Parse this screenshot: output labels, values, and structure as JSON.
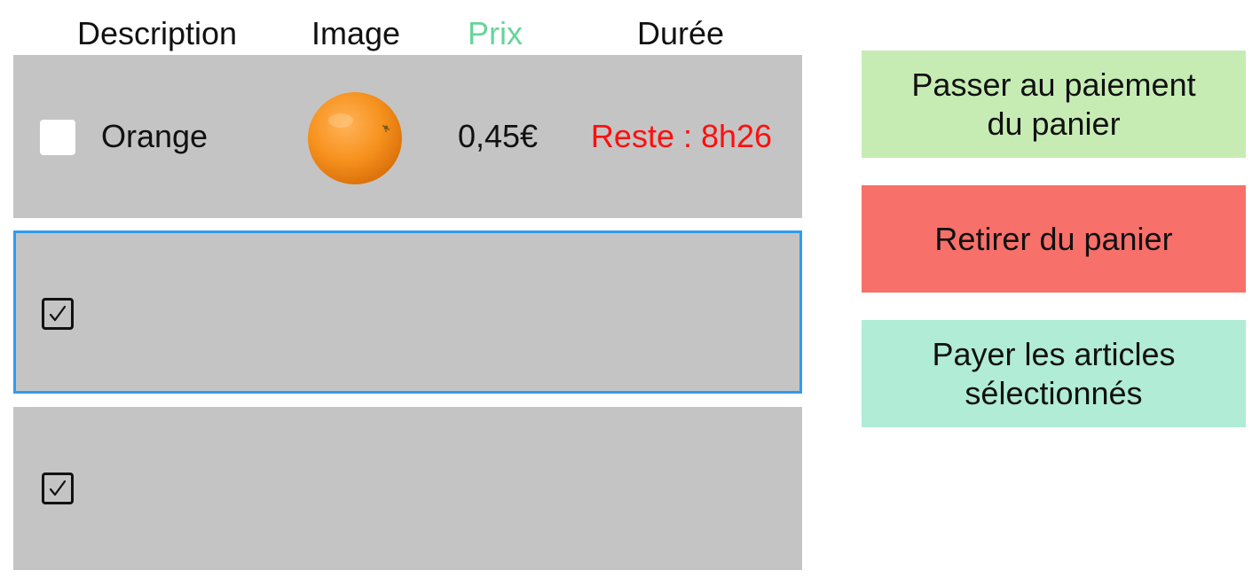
{
  "columns": {
    "description": "Description",
    "image": "Image",
    "price": "Prix",
    "duration": "Durée"
  },
  "colors": {
    "price_header": "#67d49a",
    "remaining_text": "#ff0f0f",
    "row_background": "#c4c4c4",
    "selected_row_border": "#2f9bf0"
  },
  "items": [
    {
      "name": "Orange",
      "image": "orange-icon",
      "price": "0,45€",
      "remaining": "Reste : 8h26",
      "checked": false
    },
    {
      "name": "",
      "checked": true,
      "selected": true
    },
    {
      "name": "",
      "checked": true,
      "selected": false
    }
  ],
  "actions": {
    "checkout_line1": "Passer au paiement",
    "checkout_line2": "du panier",
    "remove": "Retirer du panier",
    "pay_selected_line1": "Payer les articles",
    "pay_selected_line2": "sélectionnés",
    "checkout_color": "#c6ecb4",
    "remove_color": "#f8706a",
    "pay_selected_color": "#b1ecd6"
  }
}
